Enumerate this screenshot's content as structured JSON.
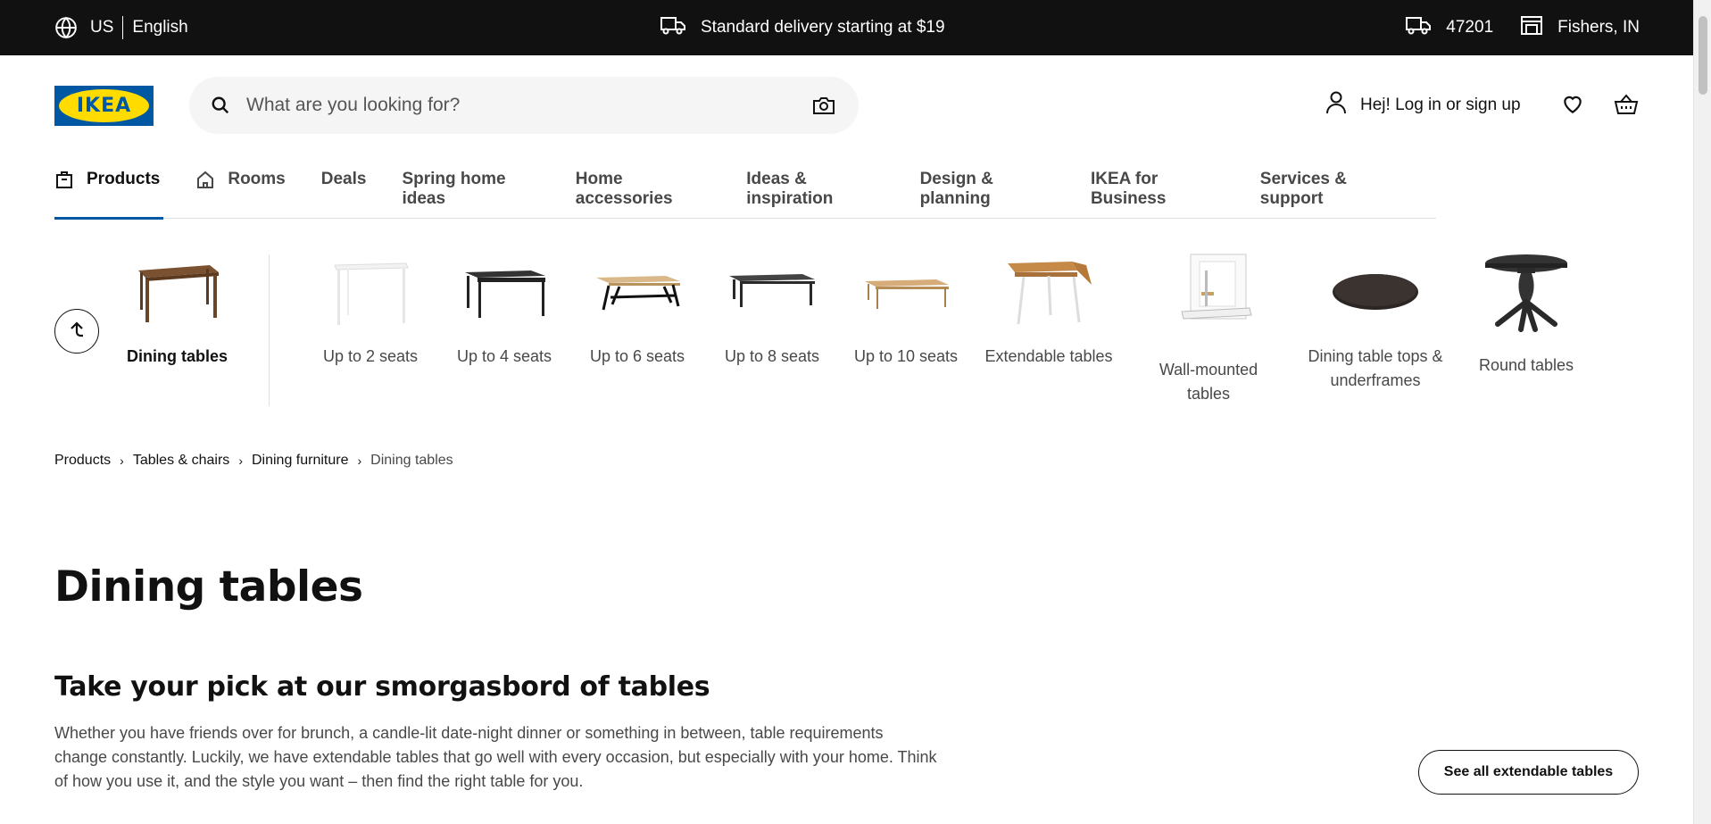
{
  "topbar": {
    "country": "US",
    "language": "English",
    "delivery": "Standard delivery starting at $19",
    "zip": "47201",
    "store": "Fishers, IN"
  },
  "header": {
    "logo_text": "IKEA",
    "search_placeholder": "What are you looking for?",
    "account_label": "Hej! Log in or sign up"
  },
  "nav": {
    "tabs": [
      {
        "label": "Products"
      },
      {
        "label": "Rooms"
      },
      {
        "label": "Deals"
      },
      {
        "label": "Spring home ideas"
      },
      {
        "label": "Home accessories"
      },
      {
        "label": "Ideas & inspiration"
      },
      {
        "label": "Design & planning"
      },
      {
        "label": "IKEA for Business"
      },
      {
        "label": "Services & support"
      }
    ]
  },
  "categories": {
    "current": "Dining tables",
    "items": [
      {
        "line1": "Up to 2 seats",
        "line2": ""
      },
      {
        "line1": "Up to 4 seats",
        "line2": ""
      },
      {
        "line1": "Up to 6 seats",
        "line2": ""
      },
      {
        "line1": "Up to 8 seats",
        "line2": ""
      },
      {
        "line1": "Up to 10 seats",
        "line2": ""
      },
      {
        "line1": "Extendable tables",
        "line2": ""
      },
      {
        "line1": "Wall-mounted",
        "line2": "tables"
      },
      {
        "line1": "Dining table tops &",
        "line2": "underframes"
      },
      {
        "line1": "Round tables",
        "line2": ""
      }
    ]
  },
  "breadcrumb": [
    "Products",
    "Tables & chairs",
    "Dining furniture",
    "Dining tables"
  ],
  "page": {
    "title": "Dining tables",
    "subtitle": "Take your pick at our smorgasbord of tables",
    "intro_lines": [
      "Whether you have friends over for brunch, a candle-lit date-night dinner or something in between, table requirements",
      "change constantly. Luckily, we have extendable tables that go well with every occasion, but especially with your home. Think",
      "of how you use it, and the style you want – then find the right table for you."
    ],
    "see_all_button": "See all extendable tables"
  },
  "colors": {
    "topbar_bg": "#111111",
    "brand_blue": "#0058a3",
    "brand_yellow": "#ffdb00"
  }
}
